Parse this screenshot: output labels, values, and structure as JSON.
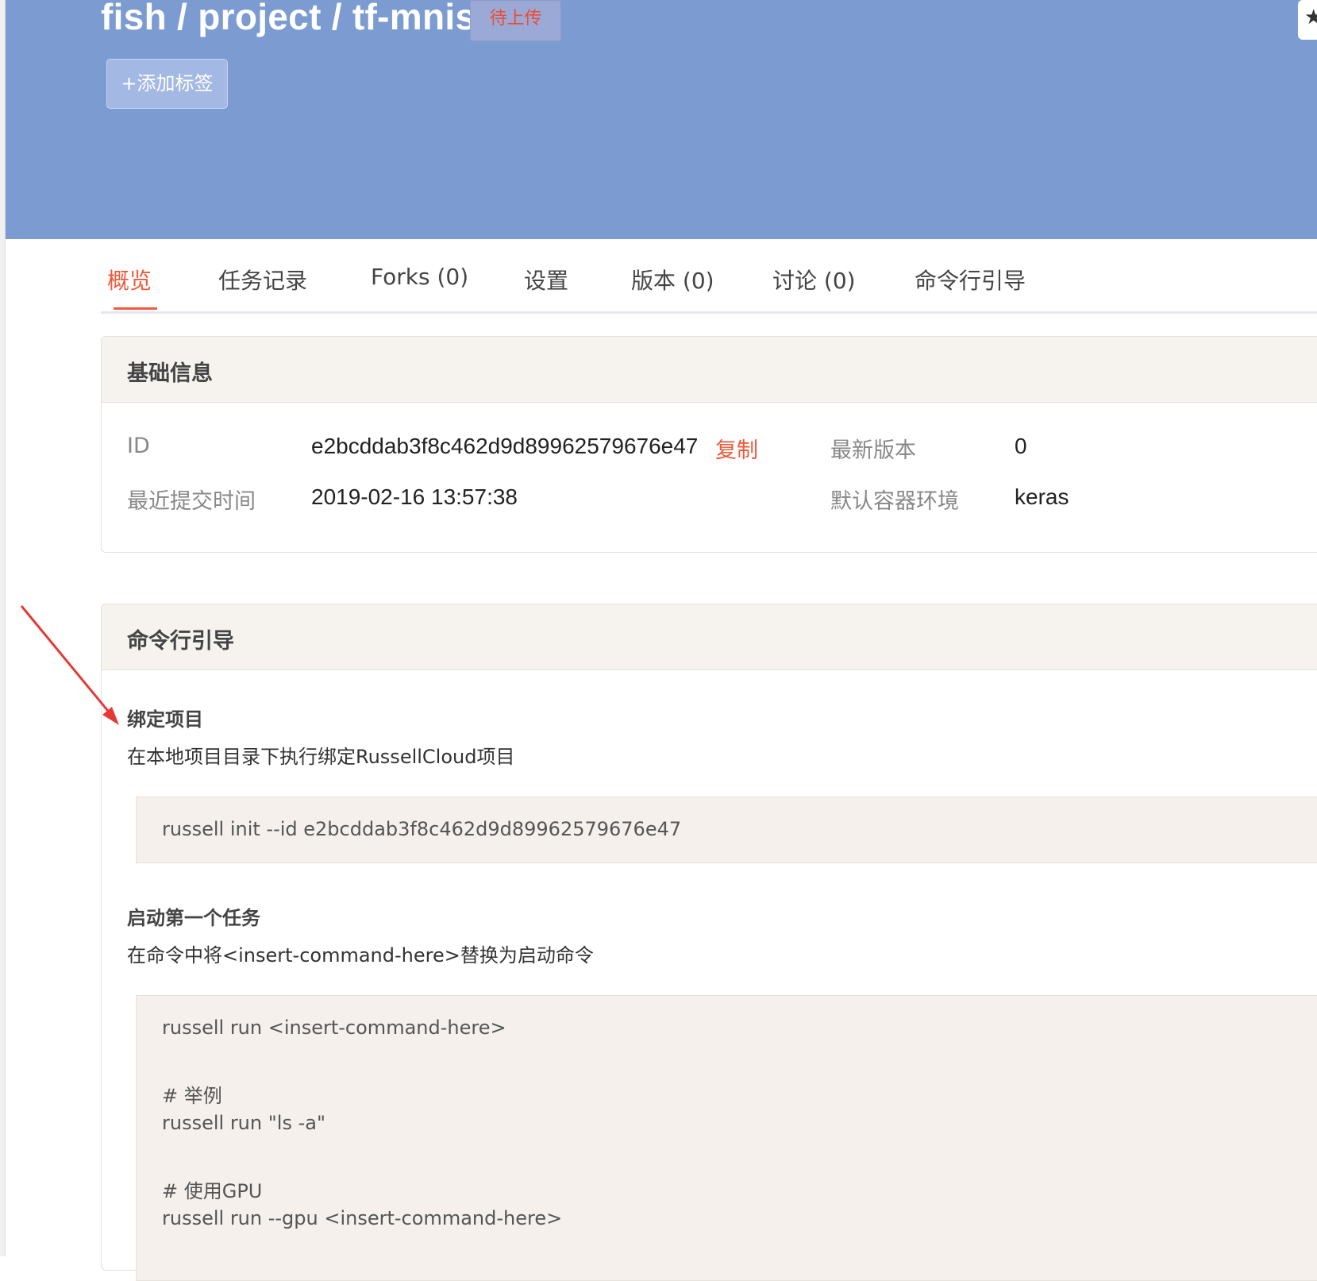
{
  "header": {
    "repo_path": "fish / project / tf-mnist",
    "status_badge": "待上传",
    "add_tag_label": "+添加标签",
    "star_glyph": "★"
  },
  "tabs": [
    {
      "label": "概览",
      "active": true
    },
    {
      "label": "任务记录",
      "active": false
    },
    {
      "label": "Forks (0)",
      "active": false
    },
    {
      "label": "设置",
      "active": false
    },
    {
      "label": "版本 (0)",
      "active": false
    },
    {
      "label": "讨论 (0)",
      "active": false
    },
    {
      "label": "命令行引导",
      "active": false
    }
  ],
  "basic_info": {
    "title": "基础信息",
    "id_label": "ID",
    "id_value": "e2bcddab3f8c462d9d89962579676e47",
    "copy_label": "复制",
    "latest_version_label": "最新版本",
    "latest_version_value": "0",
    "last_commit_label": "最近提交时间",
    "last_commit_value": "2019-02-16 13:57:38",
    "default_env_label": "默认容器环境",
    "default_env_value": "keras"
  },
  "cli_guide": {
    "title": "命令行引导",
    "bind": {
      "heading": "绑定项目",
      "description": "在本地项目目录下执行绑定RussellCloud项目",
      "code": "russell init --id e2bcddab3f8c462d9d89962579676e47"
    },
    "first_task": {
      "heading": "启动第一个任务",
      "description": "在命令中将<insert-command-here>替换为启动命令",
      "code_lines": [
        "russell run <insert-command-here>",
        "# 举例",
        "russell run \"ls -a\"",
        "# 使用GPU",
        "russell run --gpu <insert-command-here>"
      ]
    }
  },
  "colors": {
    "hero": "#7b9bd1",
    "accent": "#ef5a3c",
    "annotation_arrow": "#e53935",
    "code_bg": "#f5f0eb"
  }
}
